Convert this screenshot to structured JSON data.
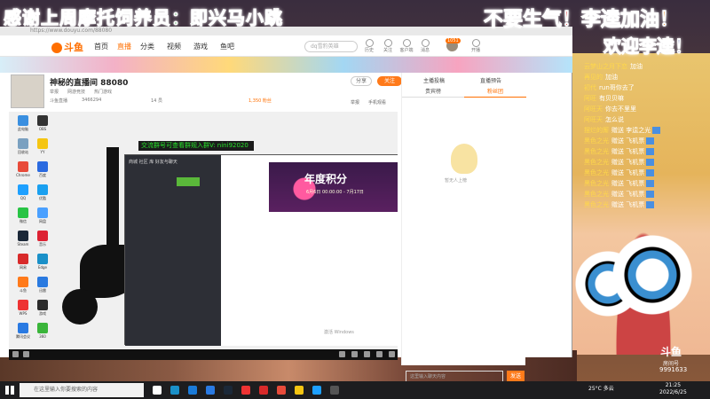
{
  "overlay": {
    "banner_top": "感谢上周摩托饲养员：即兴马小跳",
    "banner_right_1_prefix": "不要生气！",
    "banner_right_1_name": "李逵加油！",
    "banner_right_2": "欢迎李逵！"
  },
  "browser": {
    "address_text": "https://www.douyu.com/88080",
    "logo": "斗鱼",
    "nav_items": [
      "首页",
      "直播",
      "分类",
      "视频",
      "游戏",
      "鱼吧"
    ],
    "search_placeholder": "dq雪豹英雄",
    "nav_icons": [
      {
        "name": "history",
        "label": "历史"
      },
      {
        "name": "follow",
        "label": "关注"
      },
      {
        "name": "download",
        "label": "客户端"
      },
      {
        "name": "message",
        "label": "消息"
      },
      {
        "name": "live",
        "label": "开播"
      }
    ],
    "notification_count": "1051"
  },
  "streamer": {
    "room_title": "神秘的直播间 88080",
    "tags": [
      "举报",
      "网游竞技",
      "热门游戏"
    ],
    "follow_label": "关注",
    "share_label": "分享",
    "anchor_name": "斗鱼直播",
    "stats": [
      "3466294",
      "14 员",
      "1,350 粉丝"
    ],
    "report_label": "举报",
    "phone_watch": "手机观看"
  },
  "video": {
    "qq_banner": "交流群号可查看群规入群V: nini92020",
    "app_tabs": [
      "商城",
      "社区",
      "库",
      "好友与聊天"
    ],
    "promo_title": "年度积分",
    "promo_sub": "6月6日 00:00:00 - 7月17日",
    "windows_activate": "激活 Windows",
    "desktop_icons": [
      {
        "label": "此电脑",
        "color": "#3a8fe0"
      },
      {
        "label": "回收站",
        "color": "#7aa0c0"
      },
      {
        "label": "Chrome",
        "color": "#e84b3a"
      },
      {
        "label": "QQ",
        "color": "#1ea0ff"
      },
      {
        "label": "微信",
        "color": "#28c445"
      },
      {
        "label": "Steam",
        "color": "#1b2838"
      },
      {
        "label": "网易",
        "color": "#d82a2a"
      },
      {
        "label": "斗鱼",
        "color": "#ff7a1a"
      },
      {
        "label": "WPS",
        "color": "#e33"
      },
      {
        "label": "腾讯会议",
        "color": "#2a7ae2"
      },
      {
        "label": "OBS",
        "color": "#333"
      },
      {
        "label": "YY",
        "color": "#f5c512"
      },
      {
        "label": "百度",
        "color": "#2a6ae0"
      },
      {
        "label": "优酷",
        "color": "#1aa0f0"
      },
      {
        "label": "网盘",
        "color": "#4aa0ff"
      },
      {
        "label": "音乐",
        "color": "#d23"
      },
      {
        "label": "Edge",
        "color": "#1a90c8"
      },
      {
        "label": "迅雷",
        "color": "#2a7ae0"
      },
      {
        "label": "游戏",
        "color": "#2c2c2c"
      },
      {
        "label": "360",
        "color": "#3ab53a"
      }
    ]
  },
  "side": {
    "top_label": "主播投稿",
    "top_label_2": "直播预告",
    "tabs": [
      "贵宾榜",
      "粉丝团"
    ],
    "mascot_text": "暂无人上榜",
    "chat_placeholder": "这里输入聊天内容",
    "send_label": "发送"
  },
  "danmaku": [
    {
      "user": "云梦山之月下恋",
      "text": "加油",
      "gift": false
    },
    {
      "user": "再见的",
      "text": "加油",
      "gift": false
    },
    {
      "user": "初代",
      "text": "run哥你去了",
      "gift": false
    },
    {
      "user": "阿旺",
      "text": "有贝贝嘛",
      "gift": false
    },
    {
      "user": "阿旺天",
      "text": "你去不里里",
      "gift": false
    },
    {
      "user": "阿旺天",
      "text": "怎么说",
      "gift": false
    },
    {
      "user": "摆烂的厮",
      "text": "赠送 李逵之光",
      "gift": true
    },
    {
      "user": "黑色之光",
      "text": "赠送 飞机票",
      "gift": true
    },
    {
      "user": "黑色之光",
      "text": "赠送 飞机票",
      "gift": true
    },
    {
      "user": "黑色之光",
      "text": "赠送 飞机票",
      "gift": true
    },
    {
      "user": "黑色之光",
      "text": "赠送 飞机票",
      "gift": true
    },
    {
      "user": "黑色之光",
      "text": "赠送 飞机票",
      "gift": true
    },
    {
      "user": "黑色之光",
      "text": "赠送 飞机票",
      "gift": true
    },
    {
      "user": "黑色之光",
      "text": "赠送 飞机票",
      "gift": true
    }
  ],
  "corner": {
    "douyu": "斗鱼",
    "room": "房间号",
    "uid": "9991633"
  },
  "taskbar": {
    "search_placeholder": "在这里输入你要搜索的内容",
    "weather": "25°C 多云",
    "time": "21:25",
    "date": "2022/6/25",
    "apps": [
      {
        "name": "task-view",
        "color": "#fff"
      },
      {
        "name": "edge",
        "color": "#1a90c8"
      },
      {
        "name": "store",
        "color": "#1a7ad8"
      },
      {
        "name": "mail",
        "color": "#2a7ae2"
      },
      {
        "name": "steam",
        "color": "#1b2838"
      },
      {
        "name": "game",
        "color": "#e33"
      },
      {
        "name": "netease",
        "color": "#d82a2a"
      },
      {
        "name": "chrome",
        "color": "#e84b3a"
      },
      {
        "name": "files",
        "color": "#f5c512"
      },
      {
        "name": "qq",
        "color": "#1ea0ff"
      },
      {
        "name": "obs",
        "color": "#555"
      }
    ]
  }
}
